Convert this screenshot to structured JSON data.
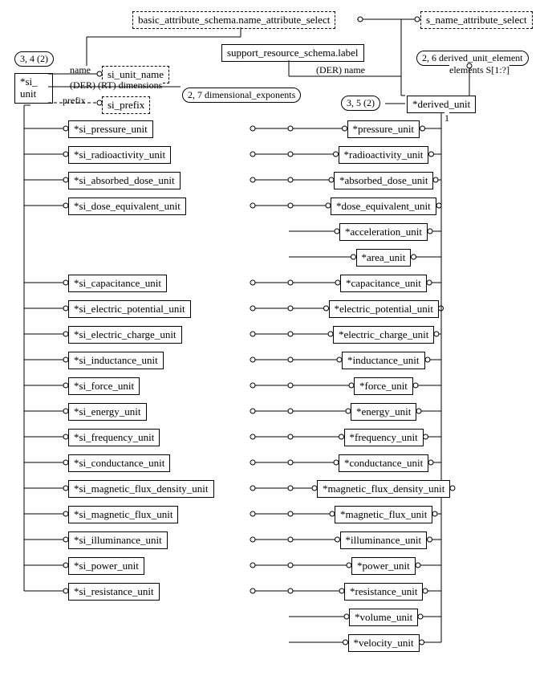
{
  "top": {
    "basic_attr": "basic_attribute_schema.name_attribute_select",
    "s_name_attr": "s_name_attribute_select",
    "support_label": "support_resource_schema.label"
  },
  "entities": {
    "si_unit": "*si_\nunit",
    "si_unit_name": "si_unit_name",
    "si_prefix": "si_prefix",
    "dimensional_exponents": "dimensional_exponents",
    "derived_unit": "*derived_unit",
    "derived_unit_element": "derived_unit_element"
  },
  "tags": {
    "t34": "3, 4 (2)",
    "t27": "2, 7",
    "t35": "3, 5 (2)",
    "t26": "2, 6"
  },
  "labels": {
    "name": "name",
    "der_rt_dim": "(DER) (RT) dimensions",
    "prefix": "prefix",
    "der_name": "(DER) name",
    "elements": "elements S[1:?]",
    "one": "1"
  },
  "si_rows": [
    "*si_pressure_unit",
    "*si_radioactivity_unit",
    "*si_absorbed_dose_unit",
    "*si_dose_equivalent_unit",
    "*si_capacitance_unit",
    "*si_electric_potential_unit",
    "*si_electric_charge_unit",
    "*si_inductance_unit",
    "*si_force_unit",
    "*si_energy_unit",
    "*si_frequency_unit",
    "*si_conductance_unit",
    "*si_magnetic_flux_density_unit",
    "*si_magnetic_flux_unit",
    "*si_illuminance_unit",
    "*si_power_unit",
    "*si_resistance_unit"
  ],
  "du_rows": [
    "*pressure_unit",
    "*radioactivity_unit",
    "*absorbed_dose_unit",
    "*dose_equivalent_unit",
    "*acceleration_unit",
    "*area_unit",
    "*capacitance_unit",
    "*electric_potential_unit",
    "*electric_charge_unit",
    "*inductance_unit",
    "*force_unit",
    "*energy_unit",
    "*frequency_unit",
    "*conductance_unit",
    "*magnetic_flux_density_unit",
    "*magnetic_flux_unit",
    "*illuminance_unit",
    "*power_unit",
    "*resistance_unit",
    "*volume_unit",
    "*velocity_unit"
  ],
  "si_to_du": [
    0,
    1,
    2,
    3,
    6,
    7,
    8,
    9,
    10,
    11,
    12,
    13,
    14,
    15,
    16,
    17,
    18
  ]
}
